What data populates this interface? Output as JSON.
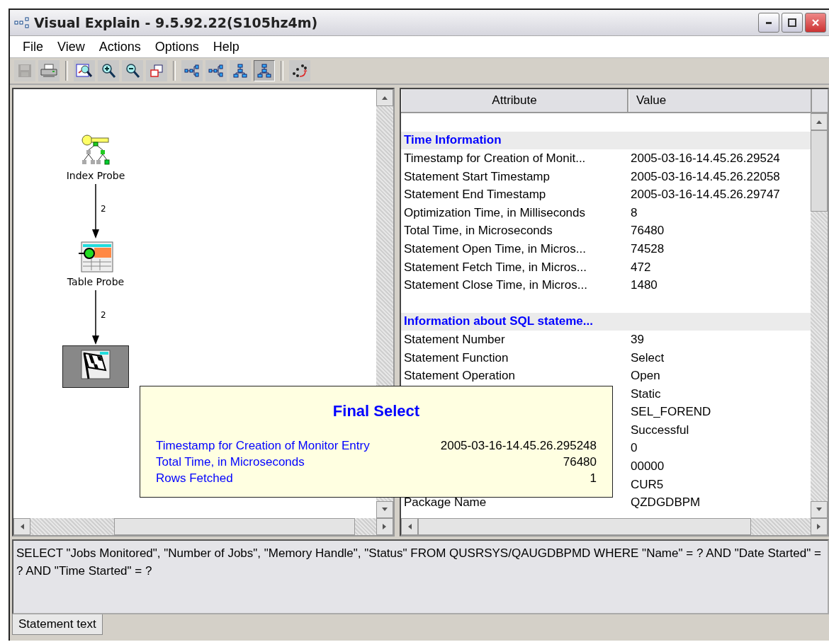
{
  "window": {
    "title": "Visual Explain - 9.5.92.22(S105hz4m)"
  },
  "menu": [
    "File",
    "View",
    "Actions",
    "Options",
    "Help"
  ],
  "toolbar_groups": [
    {
      "buttons": [
        {
          "kind": "save",
          "disabled": true,
          "selected": false
        },
        {
          "kind": "print",
          "disabled": false,
          "selected": false
        }
      ]
    },
    {
      "buttons": [
        {
          "kind": "zoom-fit",
          "disabled": false,
          "selected": false
        },
        {
          "kind": "zoom-in",
          "disabled": false,
          "selected": false
        },
        {
          "kind": "zoom-out",
          "disabled": false,
          "selected": false
        },
        {
          "kind": "overview",
          "disabled": false,
          "selected": false
        }
      ]
    },
    {
      "buttons": [
        {
          "kind": "graph-right",
          "disabled": false,
          "selected": false
        },
        {
          "kind": "graph-left",
          "disabled": false,
          "selected": false
        },
        {
          "kind": "graph-down",
          "disabled": false,
          "selected": false
        },
        {
          "kind": "graph-up",
          "disabled": false,
          "selected": true
        }
      ]
    },
    {
      "buttons": [
        {
          "kind": "animate",
          "disabled": false,
          "selected": false
        }
      ]
    }
  ],
  "diagram": {
    "nodes": [
      {
        "kind": "index-probe",
        "label": "Index Probe",
        "selected": false
      },
      {
        "kind": "table-probe",
        "label": "Table Probe",
        "selected": false
      },
      {
        "kind": "final-select",
        "selected": true
      }
    ],
    "edges": [
      {
        "label": "2"
      },
      {
        "label": "2"
      }
    ]
  },
  "attributes": {
    "columns": [
      "Attribute",
      "Value"
    ],
    "groups": [
      {
        "title": "Time Information",
        "rows": [
          {
            "attribute": "Timestamp for Creation of Monit...",
            "value": "2005-03-16-14.45.26.29524"
          },
          {
            "attribute": "Statement Start Timestamp",
            "value": "2005-03-16-14.45.26.22058"
          },
          {
            "attribute": "Statement End Timestamp",
            "value": "2005-03-16-14.45.26.29747"
          },
          {
            "attribute": "Optimization Time, in Milliseconds",
            "value": "8"
          },
          {
            "attribute": "Total Time, in Microseconds",
            "value": "76480"
          },
          {
            "attribute": "Statement Open Time, in Micros...",
            "value": "74528"
          },
          {
            "attribute": "Statement Fetch Time, in Micros...",
            "value": "472"
          },
          {
            "attribute": "Statement Close Time, in Micros...",
            "value": "1480"
          }
        ]
      },
      {
        "title": "Information about SQL stateme...",
        "rows": [
          {
            "attribute": "Statement Number",
            "value": "39"
          },
          {
            "attribute": "Statement Function",
            "value": "Select"
          },
          {
            "attribute": "Statement Operation",
            "value": "Open"
          },
          {
            "value": "Static"
          },
          {
            "value": "SEL_FOREND"
          },
          {
            "value": "Successful"
          },
          {
            "value": "0"
          },
          {
            "value": "00000"
          },
          {
            "value": "CUR5"
          },
          {
            "attribute": "Package Name",
            "value": "QZDGDBPM"
          }
        ]
      }
    ]
  },
  "tooltip": {
    "title": "Final Select",
    "rows": [
      {
        "label": "Timestamp for Creation of Monitor Entry",
        "value": "2005-03-16-14.45.26.295248"
      },
      {
        "label": "Total Time, in Microseconds",
        "value": "76480"
      },
      {
        "label": "Rows Fetched",
        "value": "1"
      }
    ]
  },
  "statement": {
    "text": "SELECT \"Jobs Monitored\", \"Number of Jobs\", \"Memory Handle\", \"Status\" FROM QUSRSYS/QAUGDBPMD WHERE \"Name\" = ? AND \"Date Started\" = ? AND \"Time Started\" = ?"
  },
  "tabs": [
    {
      "label": "Statement text",
      "selected": true
    }
  ]
}
